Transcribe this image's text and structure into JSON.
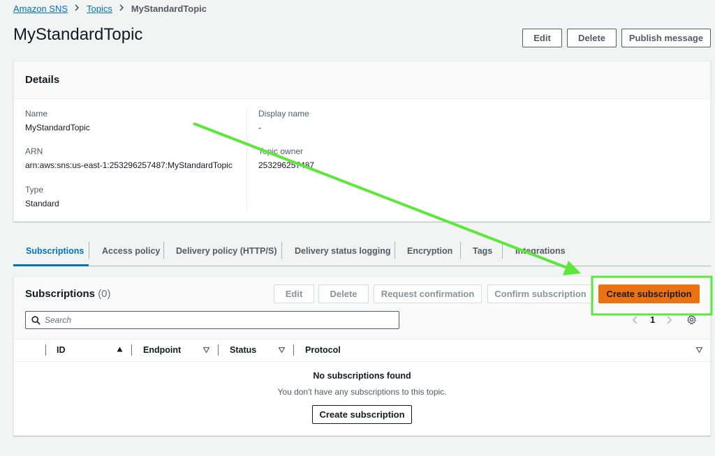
{
  "breadcrumb": [
    {
      "label": "Amazon SNS"
    },
    {
      "label": "Topics"
    },
    {
      "label": "MyStandardTopic"
    }
  ],
  "page": {
    "title": "MyStandardTopic"
  },
  "header_actions": {
    "edit": "Edit",
    "delete": "Delete",
    "publish": "Publish message"
  },
  "details": {
    "title": "Details",
    "name_label": "Name",
    "name_value": "MyStandardTopic",
    "arn_label": "ARN",
    "arn_value": "arn:aws:sns:us-east-1:253296257487:MyStandardTopic",
    "type_label": "Type",
    "type_value": "Standard",
    "display_name_label": "Display name",
    "display_name_value": "-",
    "owner_label": "Topic owner",
    "owner_value": "253296257487"
  },
  "tabs": [
    {
      "label": "Subscriptions",
      "active": true
    },
    {
      "label": "Access policy"
    },
    {
      "label": "Delivery policy (HTTP/S)"
    },
    {
      "label": "Delivery status logging"
    },
    {
      "label": "Encryption"
    },
    {
      "label": "Tags"
    },
    {
      "label": "Integrations"
    }
  ],
  "subscriptions": {
    "title": "Subscriptions",
    "count": "(0)",
    "actions": {
      "edit": "Edit",
      "delete": "Delete",
      "request_confirmation": "Request confirmation",
      "confirm_subscription": "Confirm subscription",
      "create_subscription": "Create subscription"
    },
    "search_placeholder": "Search",
    "page_number": "1",
    "columns": {
      "id": "ID",
      "endpoint": "Endpoint",
      "status": "Status",
      "protocol": "Protocol"
    },
    "empty_title": "No subscriptions found",
    "empty_message": "You don't have any subscriptions to this topic.",
    "empty_button": "Create subscription"
  },
  "colors": {
    "accent": "#0073bb",
    "primary_button": "#ec7211",
    "annotation": "#5ce83a"
  }
}
